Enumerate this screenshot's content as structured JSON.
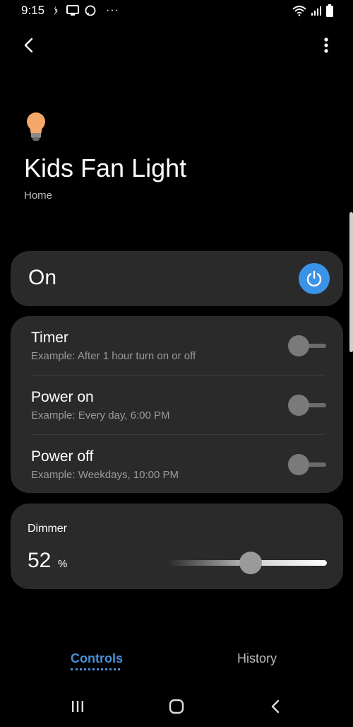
{
  "status": {
    "time": "9:15",
    "more": "···"
  },
  "device": {
    "name": "Kids Fan Light",
    "location": "Home",
    "state_label": "On",
    "powered": true
  },
  "schedule": [
    {
      "title": "Timer",
      "example": "Example: After 1 hour turn on or off",
      "enabled": false
    },
    {
      "title": "Power on",
      "example": "Example: Every day, 6:00 PM",
      "enabled": false
    },
    {
      "title": "Power off",
      "example": "Example: Weekdays, 10:00 PM",
      "enabled": false
    }
  ],
  "dimmer": {
    "label": "Dimmer",
    "value": "52",
    "unit": "%",
    "level": 0.52
  },
  "tabs": {
    "controls": "Controls",
    "history": "History",
    "active": "Controls"
  },
  "colors": {
    "accent": "#3b93e6",
    "card": "#2a2a2a",
    "bulb": "#f5a86a"
  },
  "icons": {
    "back": "back-arrow-icon",
    "more": "more-vert-icon",
    "power": "power-icon",
    "bulb": "light-bulb-icon"
  }
}
